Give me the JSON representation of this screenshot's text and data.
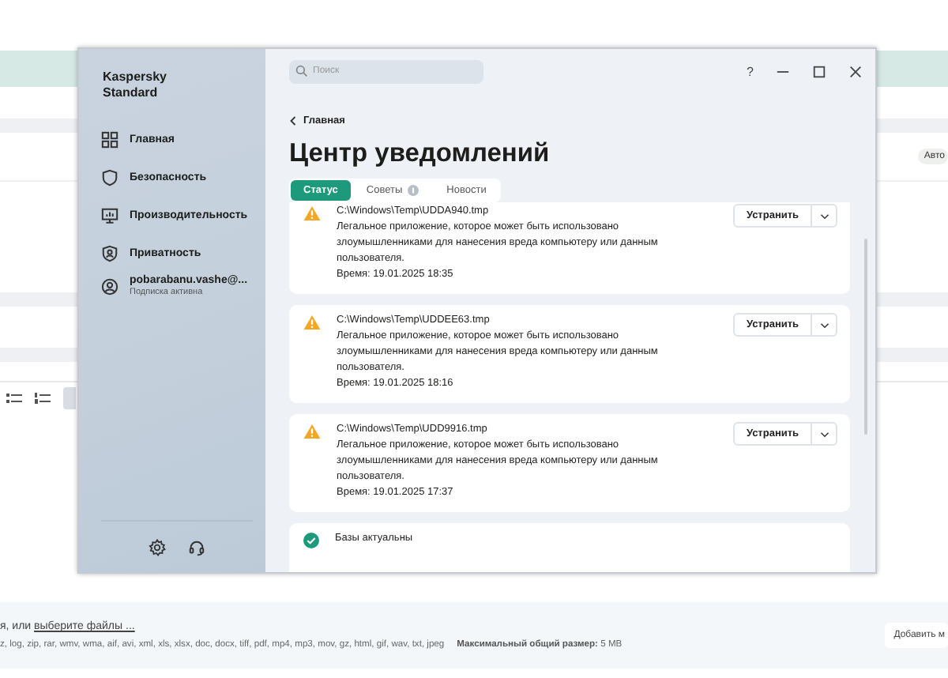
{
  "background": {
    "badge": "Авто",
    "upload": {
      "hint": "я, или ",
      "link": "выберите файлы ...",
      "formats": "z, log, zip, rar, wmv, wma, aif, avi, xml, xls, xlsx, doc, docx, tiff, pdf, mp4, mp3, mov, gz, html, gif, wav, txt, jpeg",
      "max_size": "**Максимальный общий размер:** 5 MB",
      "add_button": "Добавить м"
    }
  },
  "window": {
    "app_name": "Kaspersky Standard",
    "help": "?",
    "search": {
      "placeholder": "Поиск"
    },
    "sidebar": {
      "items": [
        {
          "label": "Главная",
          "selected": false
        },
        {
          "label": "Безопасность",
          "selected": false
        },
        {
          "label": "Производительность",
          "selected": false
        },
        {
          "label": "Приватность",
          "selected": false
        }
      ],
      "account": {
        "name": "pobarabanu.vashe@...",
        "status": "Подписка активна"
      }
    },
    "back_link": "Главная",
    "heading": "Центр уведомлений",
    "tabs": [
      {
        "label": "Статус",
        "selected": true,
        "badge": false
      },
      {
        "label": "Советы",
        "selected": false,
        "badge": true
      },
      {
        "label": "Новости",
        "selected": false,
        "badge": false
      }
    ],
    "notifications": [
      {
        "kind": "warning",
        "path": "C:\\Windows\\Temp\\UDDA940.tmp",
        "description": "Легальное приложение, которое может быть использовано злоумышленниками для нанесения вреда компьютеру или данным пользователя.",
        "time": "Время: 19.01.2025 18:35",
        "action": "Устранить"
      },
      {
        "kind": "warning",
        "path": "C:\\Windows\\Temp\\UDDEE63.tmp",
        "description": "Легальное приложение, которое может быть использовано злоумышленниками для нанесения вреда компьютеру или данным пользователя.",
        "time": "Время: 19.01.2025 18:16",
        "action": "Устранить"
      },
      {
        "kind": "warning",
        "path": "C:\\Windows\\Temp\\UDD9916.tmp",
        "description": "Легальное приложение, которое может быть использовано злоумышленниками для нанесения вреда компьютеру или данным пользователя.",
        "time": "Время: 19.01.2025 17:37",
        "action": "Устранить"
      },
      {
        "kind": "ok",
        "path": "Базы актуальны"
      }
    ]
  }
}
